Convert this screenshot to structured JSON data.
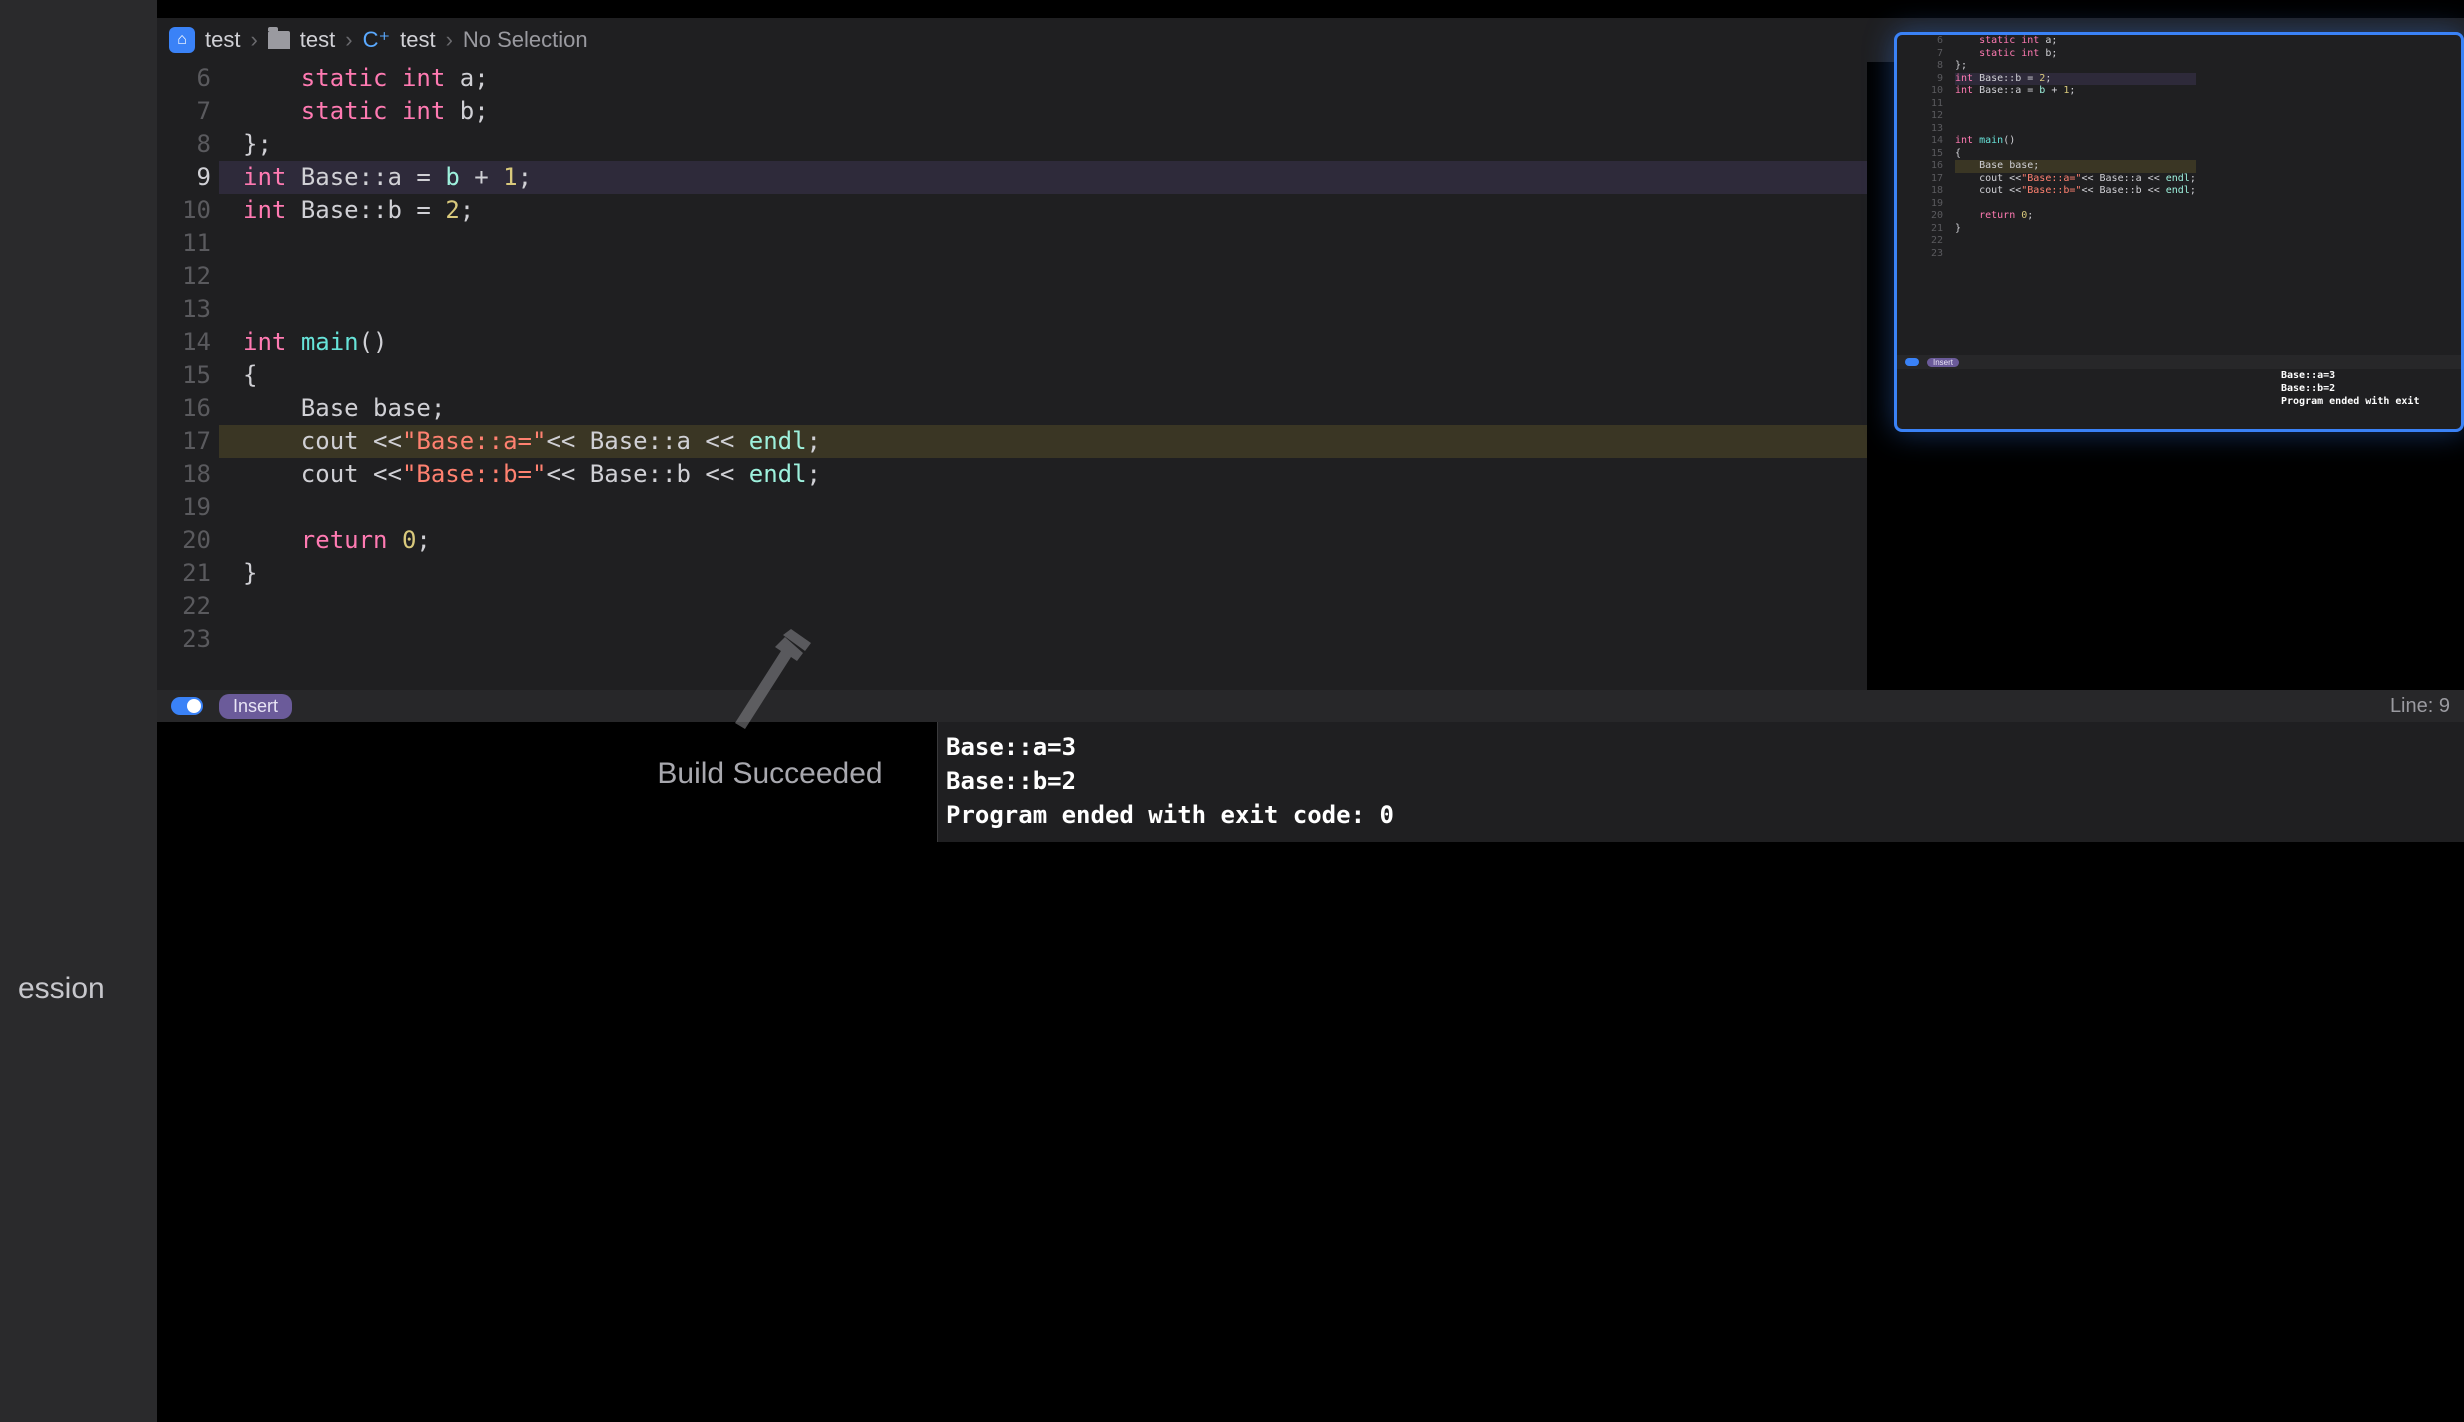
{
  "left_stub": "ession",
  "breadcrumb": {
    "project": "test",
    "folder": "test",
    "file_type": "C⁺",
    "file": "test",
    "selection": "No Selection"
  },
  "editor": {
    "first_line": 6,
    "active_line": 9,
    "warn_line": 17,
    "lines": [
      [
        [
          "    ",
          ""
        ],
        [
          "static",
          "kw"
        ],
        [
          " ",
          ""
        ],
        [
          "int",
          "ty"
        ],
        [
          " a;",
          ""
        ]
      ],
      [
        [
          "    ",
          ""
        ],
        [
          "static",
          "kw"
        ],
        [
          " ",
          ""
        ],
        [
          "int",
          "ty"
        ],
        [
          " b;",
          ""
        ]
      ],
      [
        [
          "};",
          ""
        ]
      ],
      [
        [
          "int",
          "ty"
        ],
        [
          " Base::a = ",
          ""
        ],
        [
          "b",
          "cls"
        ],
        [
          " + ",
          ""
        ],
        [
          "1",
          "nm"
        ],
        [
          ";",
          ""
        ]
      ],
      [
        [
          "int",
          "ty"
        ],
        [
          " Base::b = ",
          ""
        ],
        [
          "2",
          "nm"
        ],
        [
          ";",
          ""
        ]
      ],
      [
        [
          "",
          ""
        ]
      ],
      [
        [
          "",
          ""
        ]
      ],
      [
        [
          "",
          ""
        ]
      ],
      [
        [
          "int",
          "ty"
        ],
        [
          " ",
          ""
        ],
        [
          "main",
          "fn"
        ],
        [
          "()",
          ""
        ]
      ],
      [
        [
          "{",
          ""
        ]
      ],
      [
        [
          "    Base ",
          ""
        ],
        [
          "b",
          "id"
        ],
        [
          "ase;",
          ""
        ]
      ],
      [
        [
          "    cout <<",
          ""
        ],
        [
          "\"Base::a=\"",
          "st"
        ],
        [
          "<< Base::a << ",
          ""
        ],
        [
          "endl",
          "cls"
        ],
        [
          ";",
          ""
        ]
      ],
      [
        [
          "    cout <<",
          ""
        ],
        [
          "\"Base::b=\"",
          "st"
        ],
        [
          "<< Base::b << ",
          ""
        ],
        [
          "endl",
          "cls"
        ],
        [
          ";",
          ""
        ]
      ],
      [
        [
          "",
          ""
        ]
      ],
      [
        [
          "    ",
          ""
        ],
        [
          "return",
          "kw"
        ],
        [
          " ",
          ""
        ],
        [
          "0",
          "nm"
        ],
        [
          ";",
          ""
        ]
      ],
      [
        [
          "}",
          ""
        ]
      ],
      [
        [
          "",
          ""
        ]
      ],
      [
        [
          "",
          ""
        ]
      ]
    ]
  },
  "status": {
    "mode": "Insert",
    "line_label": "Line: 9"
  },
  "console": [
    "Base::a=3",
    "Base::b=2",
    "Program ended with exit code: 0"
  ],
  "toast": "Build Succeeded",
  "inset": {
    "first_line": 6,
    "status_mode": "Insert",
    "lines": [
      [
        [
          "    ",
          ""
        ],
        [
          "static",
          "kw"
        ],
        [
          " ",
          ""
        ],
        [
          "int",
          "ty"
        ],
        [
          " a;",
          ""
        ]
      ],
      [
        [
          "    ",
          ""
        ],
        [
          "static",
          "kw"
        ],
        [
          " ",
          ""
        ],
        [
          "int",
          "ty"
        ],
        [
          " b;",
          ""
        ]
      ],
      [
        [
          "};",
          ""
        ]
      ],
      [
        [
          "int",
          "ty"
        ],
        [
          " Base::b = ",
          ""
        ],
        [
          "2",
          "nm"
        ],
        [
          ";",
          ""
        ]
      ],
      [
        [
          "int",
          "ty"
        ],
        [
          " Base::a = ",
          ""
        ],
        [
          "b",
          "cls"
        ],
        [
          " + ",
          ""
        ],
        [
          "1",
          "nm"
        ],
        [
          ";",
          ""
        ]
      ],
      [
        [
          "",
          ""
        ]
      ],
      [
        [
          "",
          ""
        ]
      ],
      [
        [
          "",
          ""
        ]
      ],
      [
        [
          "int",
          "ty"
        ],
        [
          " ",
          ""
        ],
        [
          "main",
          "fn"
        ],
        [
          "()",
          ""
        ]
      ],
      [
        [
          "{",
          ""
        ]
      ],
      [
        [
          "    Base ",
          ""
        ],
        [
          "b",
          "id"
        ],
        [
          "ase;",
          ""
        ]
      ],
      [
        [
          "    cout <<",
          ""
        ],
        [
          "\"Base::a=\"",
          "st"
        ],
        [
          "<< Base::a << ",
          ""
        ],
        [
          "endl",
          "cls"
        ],
        [
          ";",
          ""
        ]
      ],
      [
        [
          "    cout <<",
          ""
        ],
        [
          "\"Base::b=\"",
          "st"
        ],
        [
          "<< Base::b << ",
          ""
        ],
        [
          "endl",
          "cls"
        ],
        [
          ";",
          ""
        ]
      ],
      [
        [
          "",
          ""
        ]
      ],
      [
        [
          "    ",
          ""
        ],
        [
          "return",
          "kw"
        ],
        [
          " ",
          ""
        ],
        [
          "0",
          "nm"
        ],
        [
          ";",
          ""
        ]
      ],
      [
        [
          "}",
          ""
        ]
      ],
      [
        [
          "",
          ""
        ]
      ],
      [
        [
          "",
          ""
        ]
      ]
    ],
    "console": [
      "Base::a=3",
      "Base::b=2",
      "Program ended with exit"
    ]
  }
}
